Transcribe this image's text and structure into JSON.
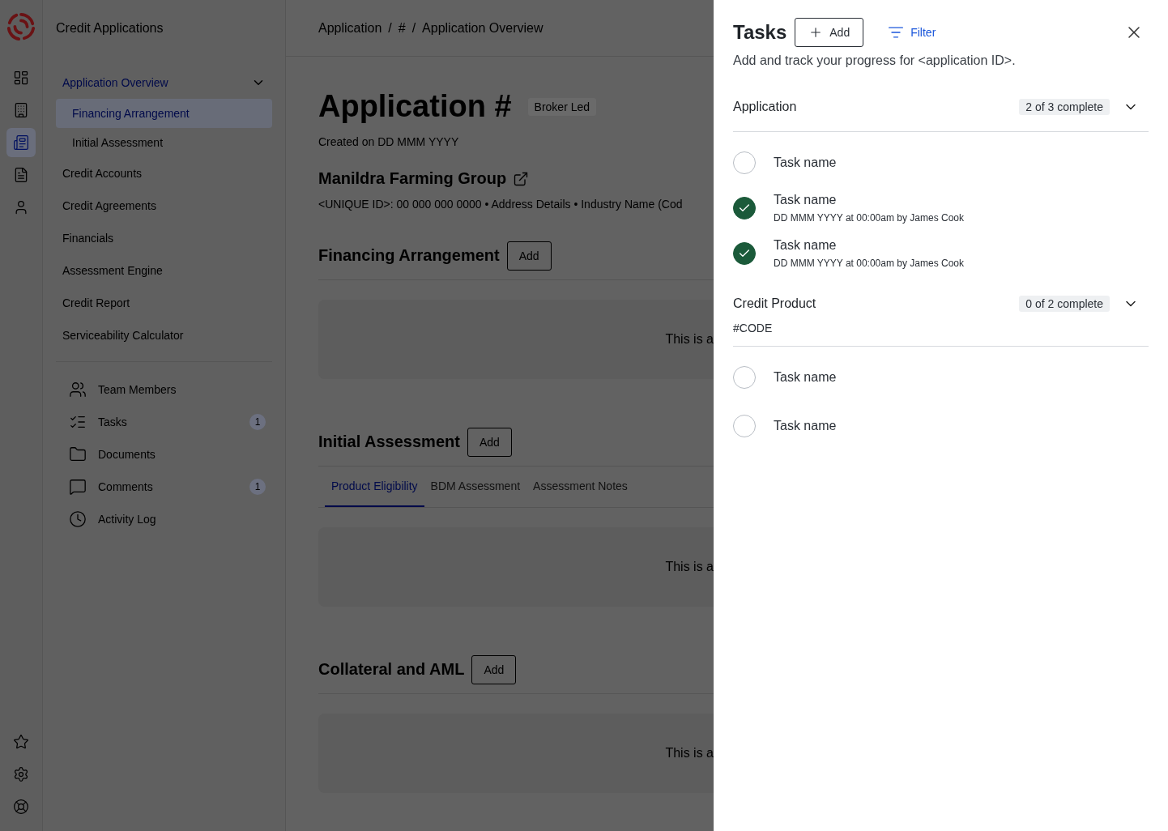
{
  "app": {
    "title": "Credit Applications"
  },
  "rail": {
    "top": [
      {
        "selected": false
      },
      {
        "selected": false
      },
      {
        "selected": true
      },
      {
        "selected": false
      },
      {
        "selected": false
      }
    ]
  },
  "nav": {
    "items": [
      {
        "label": "Application Overview",
        "expanded": true,
        "selected": true,
        "children": [
          {
            "label": "Financing Arrangement",
            "selected": true
          },
          {
            "label": "Initial Assessment",
            "selected": false
          }
        ]
      },
      {
        "label": "Credit Accounts",
        "selected": false
      },
      {
        "label": "Credit Agreements",
        "selected": false
      },
      {
        "label": "Financials",
        "selected": false
      },
      {
        "label": "Assessment Engine",
        "selected": false
      },
      {
        "label": "Credit Report",
        "selected": false
      },
      {
        "label": "Serviceability Calculator",
        "selected": false
      }
    ],
    "links": [
      {
        "label": "Team Members"
      },
      {
        "label": "Tasks",
        "badge": "1"
      },
      {
        "label": "Documents"
      },
      {
        "label": "Comments",
        "badge": "1"
      },
      {
        "label": "Activity Log"
      }
    ]
  },
  "breadcrumb": [
    "Application",
    "/",
    "#",
    "/",
    "Application Overview"
  ],
  "page": {
    "title": "Application #",
    "tag": "Broker Led",
    "created": "Created on DD MMM YYYY",
    "company": "Manildra Farming Group",
    "details": "<UNIQUE ID>: 00 000 000 0000 • Address Details • Industry Name (Cod",
    "sections": [
      {
        "title": "Financing Arrangement",
        "add": "Add",
        "placeholder": "This is a"
      },
      {
        "title": "Initial Assessment",
        "add": "Add",
        "tabs": [
          {
            "label": "Product Eligibility",
            "selected": true
          },
          {
            "label": "BDM Assessment",
            "selected": false
          },
          {
            "label": "Assessment Notes",
            "selected": false
          }
        ],
        "placeholder": "This is a"
      },
      {
        "title": "Collateral and AML",
        "add": "Add",
        "placeholder": "This is a"
      }
    ]
  },
  "drawer": {
    "title": "Tasks",
    "add": "Add",
    "filter": "Filter",
    "subtitle": "Add and track your progress for <application ID>.",
    "groups": [
      {
        "title": "Application",
        "progress": "2 of 3 complete",
        "expanded": true,
        "tasks": [
          {
            "name": "Task name",
            "done": false
          },
          {
            "name": "Task name",
            "done": true,
            "meta": "DD MMM YYYY at 00:00am by James Cook"
          },
          {
            "name": "Task name",
            "done": true,
            "meta": "DD MMM YYYY at 00:00am by James Cook"
          }
        ]
      },
      {
        "title": "Credit Product",
        "code": "#CODE",
        "progress": "0 of 2 complete",
        "expanded": true,
        "tasks": [
          {
            "name": "Task name",
            "done": false
          },
          {
            "name": "Task name",
            "done": false
          }
        ]
      }
    ]
  }
}
